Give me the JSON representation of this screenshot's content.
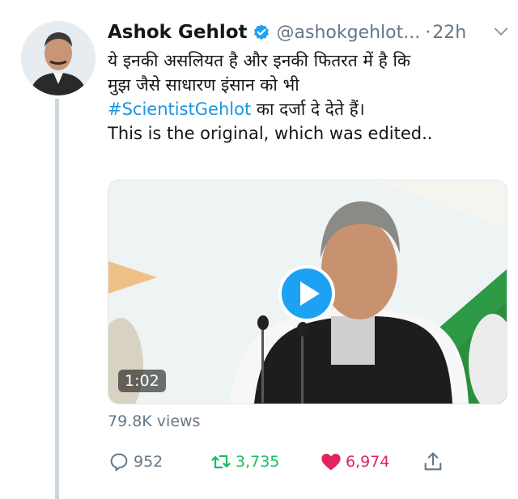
{
  "author": {
    "name": "Ashok Gehlot",
    "handle": "@ashokgehlot...",
    "separator": "·",
    "time": "22h",
    "verified": true
  },
  "tweet": {
    "line1": "ये इनकी असलियत है और इनकी फितरत में है कि",
    "line2": "मुझ जैसे साधारण इंसान को भी",
    "hashtag": "#ScientistGehlot",
    "line3_rest": " का दर्जा दे देते हैं।",
    "line4": "This is the original, which was edited.."
  },
  "video": {
    "duration": "1:02"
  },
  "views": "79.8K views",
  "actions": {
    "replies": "952",
    "retweets": "3,735",
    "likes": "6,974"
  },
  "colors": {
    "accent": "#1b95e0",
    "retweet": "#17bf63",
    "like": "#e0245e",
    "muted": "#657786"
  }
}
